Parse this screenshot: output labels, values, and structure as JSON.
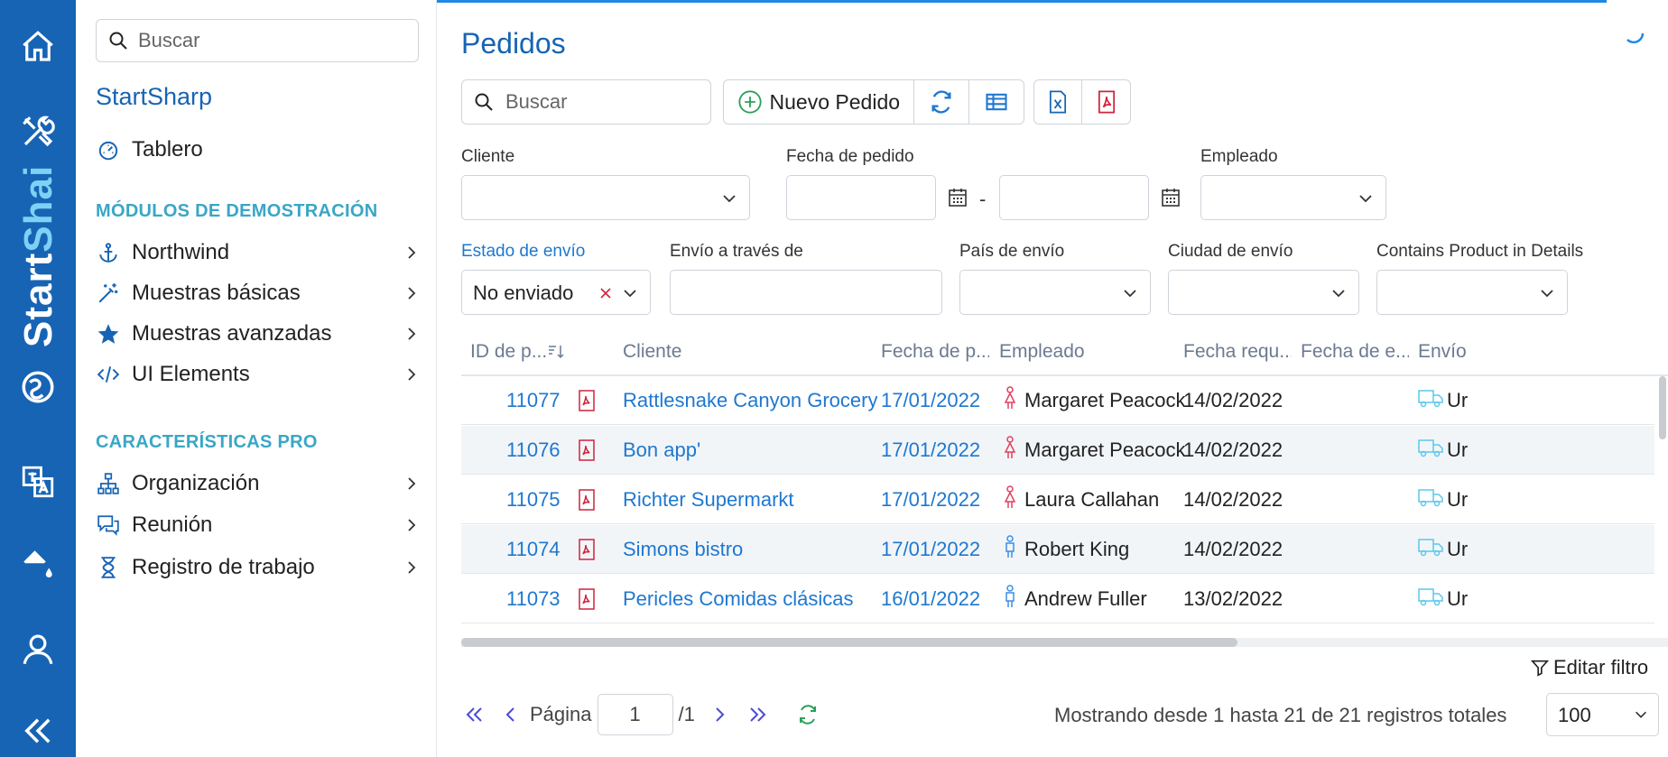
{
  "sidebar": {
    "search_placeholder": "Buscar",
    "brand": "StartSharp",
    "dashboard": "Tablero",
    "section_demo": "MÓDULOS DE DEMOSTRACIÓN",
    "demo_items": [
      "Northwind",
      "Muestras básicas",
      "Muestras avanzadas",
      "UI Elements"
    ],
    "section_pro": "CARACTERÍSTICAS PRO",
    "pro_items": [
      "Organización",
      "Reunión",
      "Registro de trabajo"
    ]
  },
  "rail": {
    "brand_part1": "Start",
    "brand_part2": "Shai"
  },
  "page": {
    "title": "Pedidos"
  },
  "toolbar": {
    "search_placeholder": "Buscar",
    "new_order": "Nuevo Pedido"
  },
  "filters": {
    "customer_label": "Cliente",
    "order_date_label": "Fecha de pedido",
    "date_sep": "-",
    "employee_label": "Empleado",
    "ship_status_label": "Estado de envío",
    "ship_status_value": "No enviado",
    "ship_via_label": "Envío a través de",
    "ship_country_label": "País de envío",
    "ship_city_label": "Ciudad de envío",
    "contains_product_label": "Contains Product in Details"
  },
  "grid": {
    "columns": [
      "ID de p...",
      "Cliente",
      "Fecha de p...",
      "Empleado",
      "Fecha requ...",
      "Fecha de e...",
      "Envío c"
    ],
    "rows": [
      {
        "id": "11077",
        "customer": "Rattlesnake Canyon Grocery",
        "order_date": "17/01/2022",
        "employee": "Margaret Peacock",
        "gender": "f",
        "required": "14/02/2022",
        "shipped": "",
        "ship_via": "Ur"
      },
      {
        "id": "11076",
        "customer": "Bon app'",
        "order_date": "17/01/2022",
        "employee": "Margaret Peacock",
        "gender": "f",
        "required": "14/02/2022",
        "shipped": "",
        "ship_via": "Ur"
      },
      {
        "id": "11075",
        "customer": "Richter Supermarkt",
        "order_date": "17/01/2022",
        "employee": "Laura Callahan",
        "gender": "f",
        "required": "14/02/2022",
        "shipped": "",
        "ship_via": "Ur"
      },
      {
        "id": "11074",
        "customer": "Simons bistro",
        "order_date": "17/01/2022",
        "employee": "Robert King",
        "gender": "m",
        "required": "14/02/2022",
        "shipped": "",
        "ship_via": "Ur"
      },
      {
        "id": "11073",
        "customer": "Pericles Comidas clásicas",
        "order_date": "16/01/2022",
        "employee": "Andrew Fuller",
        "gender": "m",
        "required": "13/02/2022",
        "shipped": "",
        "ship_via": "Ur"
      }
    ]
  },
  "footer": {
    "edit_filter": "Editar filtro",
    "page_label": "Página",
    "page_value": "1",
    "page_total": "/1",
    "status": "Mostrando desde 1 hasta 21 de 21 registros totales",
    "page_size": "100"
  },
  "colors": {
    "rail": "#1764b4",
    "accent": "#1e78d0",
    "section": "#3aa6c6",
    "pdf": "#d0243c",
    "female": "#e04060",
    "male": "#3a8ee6",
    "truck": "#5ac8ea",
    "refresh_green": "#2ca05a"
  }
}
